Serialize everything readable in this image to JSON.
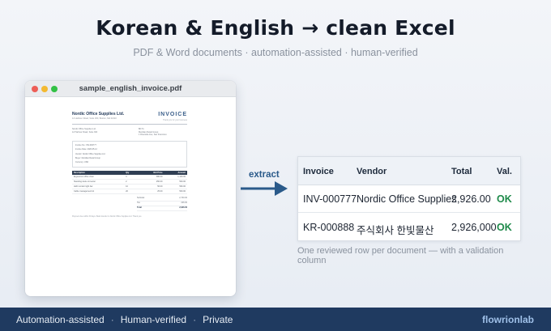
{
  "header": {
    "title": "Korean & English  →  clean Excel",
    "subtitle": "PDF & Word documents · automation-assisted · human-verified"
  },
  "window": {
    "filename": "sample_english_invoice.pdf",
    "doc": {
      "company": "Nordic Office Supplies Ltd.",
      "company_sub": "12 Harbour Road, Suite 300, Boston, MA 02110",
      "doc_title": "INVOICE",
      "doc_title_sub": "Thank you for your business",
      "from": [
        "Nordic Office Supplies Ltd.",
        "12 Harbour Road, Suite 300"
      ],
      "bill_to": [
        "Bill To",
        "Meridian Retail Group",
        "1 Riverside Ave, San Francisco"
      ],
      "meta": [
        "Invoice No.: INV-000777",
        "Invoice Date: 2026-05-12",
        "Vendor: Nordic Office Supplies Ltd.",
        "Buyer: Meridian Retail Group",
        "Currency: USD"
      ],
      "item_headers": [
        "Description",
        "Qty",
        "Unit Price",
        "Amount"
      ],
      "items": [
        [
          "Ergonomic office chair",
          "3",
          "380.00",
          "1,140.00"
        ],
        [
          "Standing desk converter",
          "2",
          "250.00",
          "500.00"
        ],
        [
          "LED monitor light bar",
          "10",
          "56.00",
          "560.00"
        ],
        [
          "Cable management kit",
          "20",
          "25.00",
          "500.00"
        ]
      ],
      "totals": [
        [
          "Subtotal",
          "2,700.00"
        ],
        [
          "Tax",
          "226.00"
        ],
        [
          "Total",
          "2,926.00"
        ]
      ],
      "footer": "Payment due within 30 days. Bank transfer to Nordic Office Supplies Ltd. Thank you."
    }
  },
  "flow": {
    "label": "extract"
  },
  "table": {
    "headers": [
      "Invoice",
      "Vendor",
      "Total",
      "Val."
    ],
    "rows": [
      [
        "INV-000777",
        "Nordic Office Supplies",
        "2,926.00",
        "OK"
      ],
      [
        "KR-000888",
        "주식회사 한빛물산",
        "2,926,000",
        "OK"
      ]
    ],
    "caption": "One reviewed row per document — with a validation column"
  },
  "footer": {
    "items": [
      "Automation-assisted",
      "Human-verified",
      "Private"
    ],
    "separator": "·",
    "brand": "flowrionlab"
  },
  "colors": {
    "footer_bg": "#1f3a60",
    "accent": "#2a5a8a",
    "ok": "#1e8a4a"
  }
}
